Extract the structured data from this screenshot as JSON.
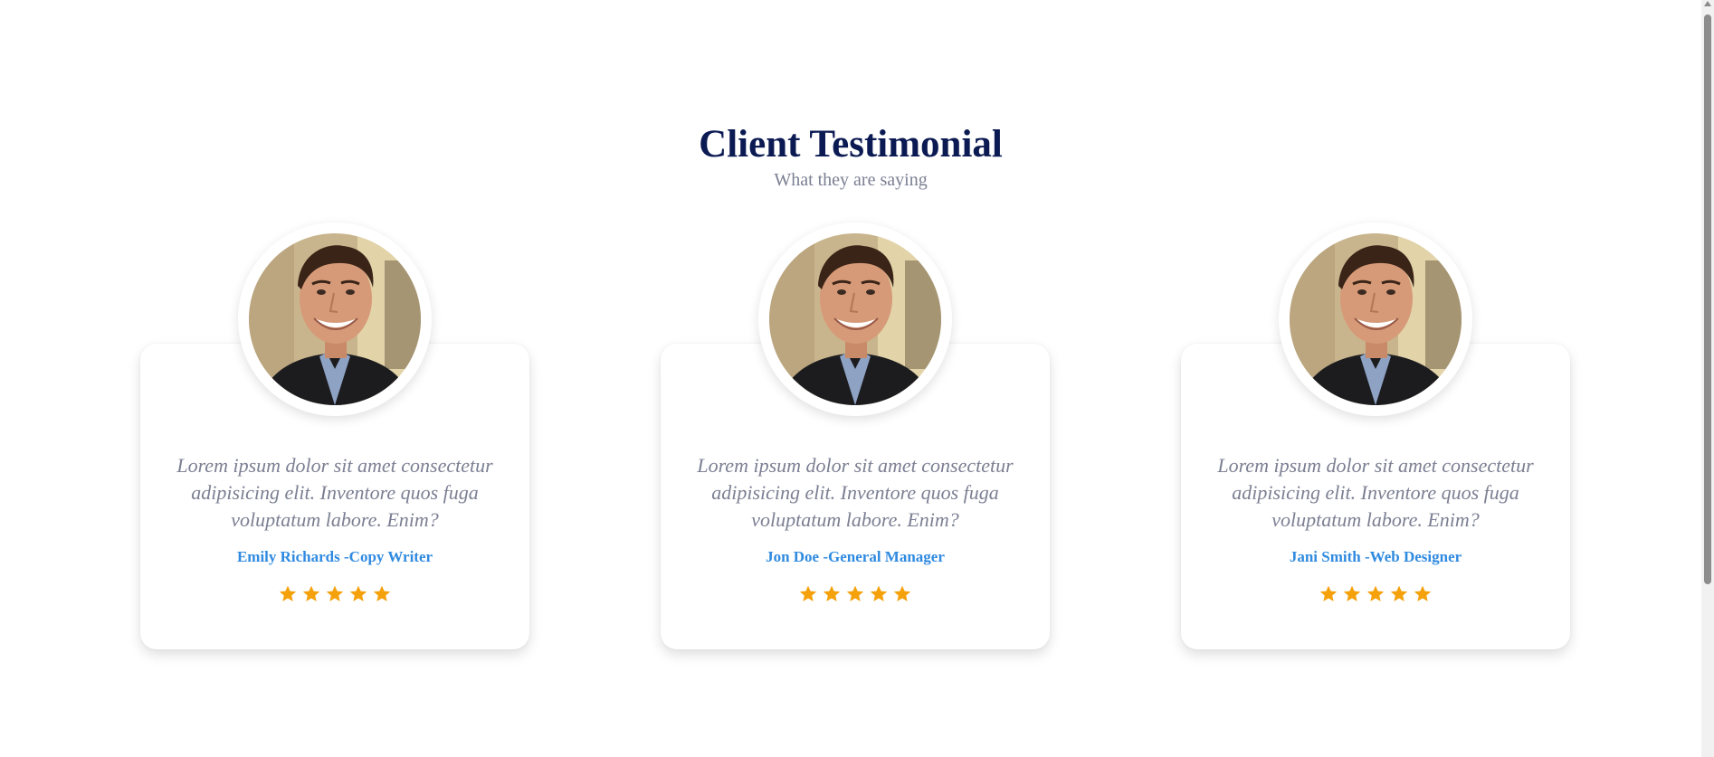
{
  "section": {
    "title": "Client Testimonial",
    "subtitle": "What they are saying"
  },
  "testimonials": [
    {
      "quote": "Lorem ipsum dolor sit amet consectetur adipisicing elit. Inventore quos fuga voluptatum labore. Enim?",
      "name": "Emily Richards -Copy Writer",
      "rating": 5
    },
    {
      "quote": "Lorem ipsum dolor sit amet consectetur adipisicing elit. Inventore quos fuga voluptatum labore. Enim?",
      "name": "Jon Doe -General Manager",
      "rating": 5
    },
    {
      "quote": "Lorem ipsum dolor sit amet consectetur adipisicing elit. Inventore quos fuga voluptatum labore. Enim?",
      "name": "Jani Smith -Web Designer",
      "rating": 5
    }
  ],
  "icons": {
    "star": "star-icon"
  },
  "colors": {
    "title": "#0b1a52",
    "subtitle": "#7a7f92",
    "name": "#2f8ae0",
    "star": "#f5a10b"
  }
}
